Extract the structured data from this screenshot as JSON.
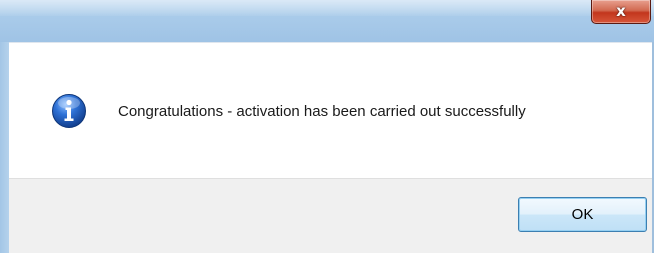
{
  "window": {
    "title": "",
    "close_icon": "close-icon",
    "close_glyph": "x"
  },
  "message": {
    "icon": "info-icon",
    "text": "Congratulations - activation has been carried out successfully"
  },
  "buttons": {
    "ok_label": "OK"
  },
  "colors": {
    "titlebar": "#a9cbea",
    "close_button": "#c2361d",
    "footer": "#f0f0f0",
    "ok_border": "#3c7fb1",
    "info_icon": "#1f5fbf"
  }
}
